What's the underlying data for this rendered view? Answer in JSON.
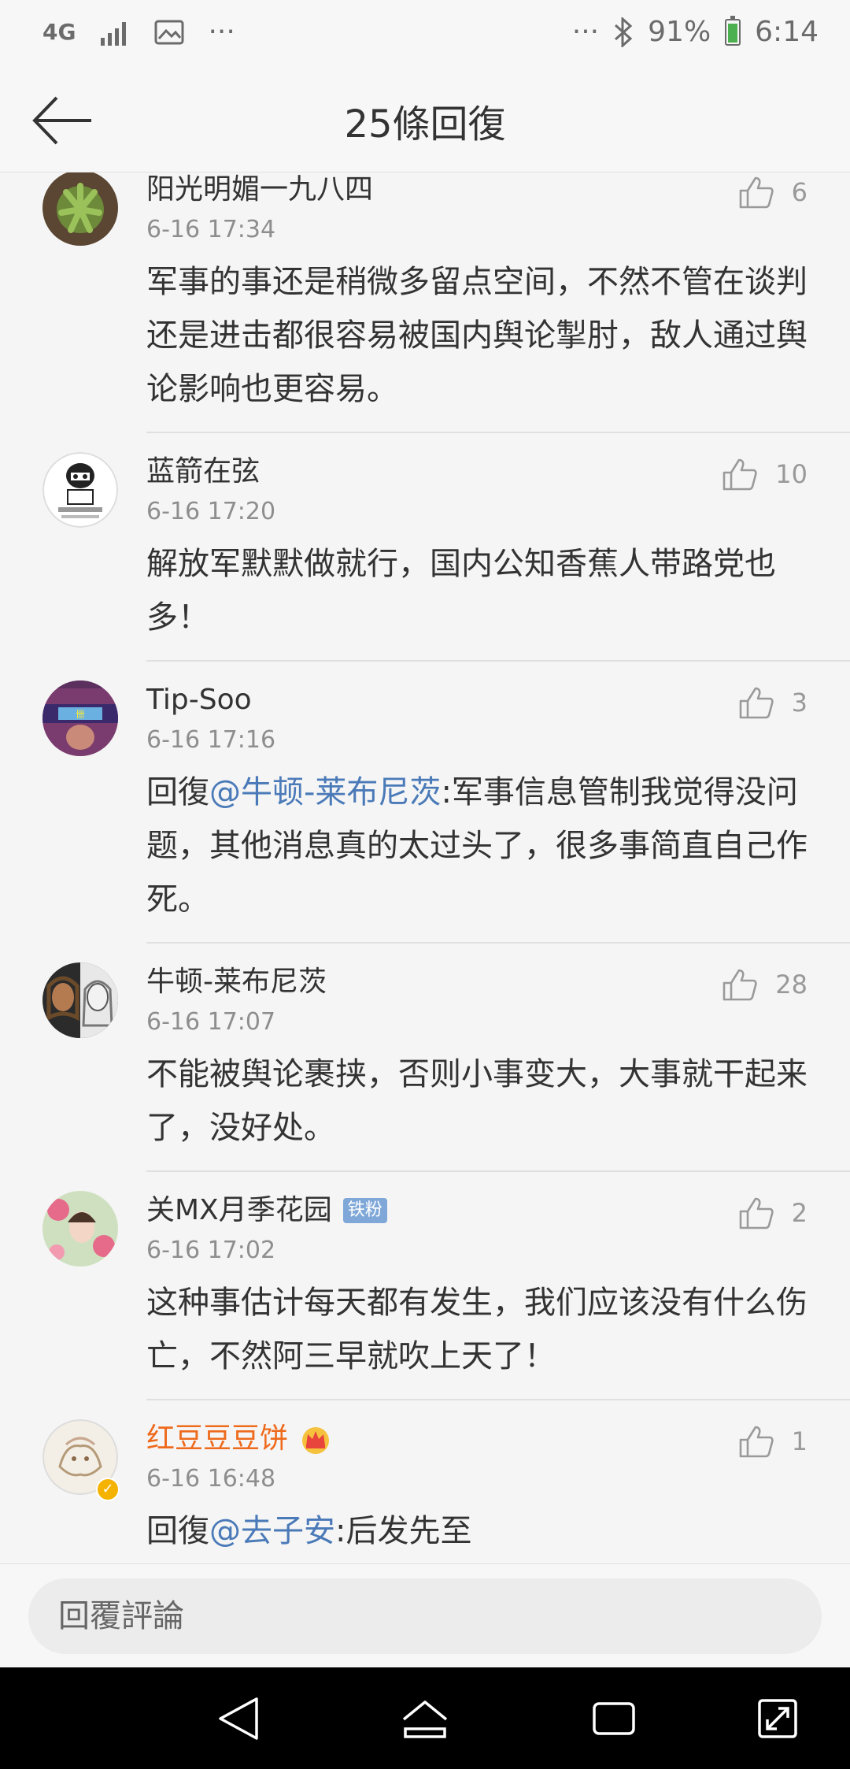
{
  "status_bar": {
    "network": "4G",
    "signal_icon": "signal-icon",
    "image_icon": "image-icon",
    "more_left": "···",
    "more_right": "···",
    "bluetooth_icon": "bluetooth-icon",
    "battery_percent": "91%",
    "battery_level": 0.91,
    "time": "6:14"
  },
  "header": {
    "title": "25條回復"
  },
  "comments": [
    {
      "name": "阳光明媚一九八四",
      "time": "6-16 17:34",
      "likes": "6",
      "text": "军事的事还是稍微多留点空间，不然不管在谈判还是进击都很容易被国内舆论掣肘，敌人通过舆论影响也更容易。"
    },
    {
      "name": "蓝箭在弦",
      "time": "6-16 17:20",
      "likes": "10",
      "text": "解放军默默做就行，国内公知香蕉人带路党也多！"
    },
    {
      "name": "Tip-Soo",
      "time": "6-16 17:16",
      "likes": "3",
      "reply_prefix": "回復",
      "mention": "@牛顿-莱布尼茨",
      "text": ":军事信息管制我觉得没问题，其他消息真的太过头了，很多事简直自己作死。"
    },
    {
      "name": "牛顿-莱布尼茨",
      "time": "6-16 17:07",
      "likes": "28",
      "text": "不能被舆论裹挟，否则小事变大，大事就干起来了，没好处。"
    },
    {
      "name": "关MX月季花园",
      "badge": "铁粉",
      "time": "6-16 17:02",
      "likes": "2",
      "text": "这种事估计每天都有发生，我们应该没有什么伤亡，不然阿三早就吹上天了！"
    },
    {
      "name": "红豆豆豆饼",
      "time": "6-16 16:48",
      "likes": "1",
      "reply_prefix": "回復",
      "mention": "@去子安",
      "text": ":后发先至"
    }
  ],
  "input": {
    "placeholder": "回覆評論"
  },
  "colors": {
    "mention": "#4a7ab8",
    "vip_name": "#ee6a1c",
    "badge_bg": "#7fa8d8",
    "battery_fill": "#4caf50"
  }
}
